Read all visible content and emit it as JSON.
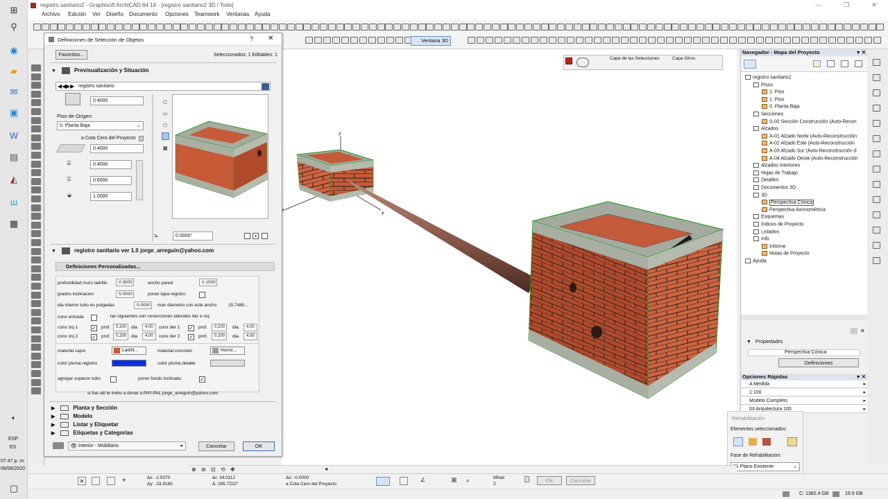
{
  "window": {
    "title": "registro sanitario2 - Graphisoft ArchiCAD-64 18 - [registro sanitario2 3D / Todo]"
  },
  "menu": [
    "Archivo",
    "Edición",
    "Ver",
    "Diseño",
    "Documento",
    "Opciones",
    "Teamwork",
    "Ventanas",
    "Ayuda"
  ],
  "toolbar": {
    "window3d_label": "Ventana 3D"
  },
  "layers": {
    "sel_label": "Capa de las Selecciones",
    "other_label": "Capa Otros"
  },
  "dialog": {
    "title": "Definiciones de Selección de Objetos",
    "help": "?",
    "favorites": "Favoritos...",
    "selected_info": "Seleccionados: 1 Editables: 1",
    "preview_section": "Previsualización y Situación",
    "object_name": "registro sanitario",
    "height_top": "0.4000",
    "floor_label": "Piso de Origen:",
    "floor_value": "0. Planta Baja",
    "zero_label": "a Cota Cero del Proyecto",
    "elev_value": "0.4000",
    "dim_a": "0.4000",
    "dim_b": "0.6000",
    "dim_c": "1.0000",
    "angle": "0.0000°",
    "lib_part": "registro sanitario ver 1.0  jorge_arreguin@yahoo.com",
    "custom_section": "Definiciones Personalizadas...",
    "params": {
      "prof_muro_label": "profundidad muro ladrillo",
      "prof_muro": "0.3000",
      "ancho_pared_label": "ancho pared",
      "ancho_pared": "0.1500",
      "grados_label": "grados inclinacion",
      "grados": "5.0000",
      "tapa_label": "poner tapa registro",
      "dia_tubo_label": "dia interior tubo en pulgadas",
      "dia_tubo": "0.0000",
      "max_dia_label": "max diametro con este ancho",
      "max_dia": "15.7480...",
      "conx_entrada_label": "conx entrada",
      "siguientes_label": "las siguientes son conecciones laterales der e izq",
      "izq1": "conx izq 1",
      "izq2": "conx izq 2",
      "der1": "conx der 1",
      "der2": "conx der 2",
      "prof": "prof.",
      "dia": "dia.",
      "v0200": "0.200",
      "v400": "4.00",
      "mat_cajon_label": "material cajon",
      "mat_cajon": "Ladrill...",
      "mat_concreto_label": "material concreto",
      "mat_concreto": "Hormi...",
      "pluma_reg_label": "color pluma registro",
      "pluma_det_label": "color pluma detalle",
      "espesor_label": "agregar espesor tubo",
      "fondo_label": "poner fondo inclinado",
      "donate": "si fue util te invito a donar a PAY-PAL jorge_arreguin@yahoo.com"
    },
    "sections": [
      "Planta y Sección",
      "Modelo",
      "Listar y Etiquetar",
      "Etiquetas y Categorías"
    ],
    "layer_value": "Interior - Mobiliario",
    "cancel": "Cancelar",
    "ok": "OK"
  },
  "viewport": {
    "axis_z": "z",
    "axis_x": "x",
    "axis_y": "y"
  },
  "navigator": {
    "title": "Navegador - Mapa del Proyecto",
    "tree": [
      {
        "label": "registro sanitario2",
        "level": 0
      },
      {
        "label": "Pisos",
        "level": 1
      },
      {
        "label": "2. Piso",
        "level": 2
      },
      {
        "label": "1. Piso",
        "level": 2
      },
      {
        "label": "0. Planta Baja",
        "level": 2
      },
      {
        "label": "Secciones",
        "level": 1
      },
      {
        "label": "S-02 Sección Construcción (Auto-Recon",
        "level": 2
      },
      {
        "label": "Alzados",
        "level": 1
      },
      {
        "label": "A-01 Alzado Norte (Auto-Reconstrucción",
        "level": 2
      },
      {
        "label": "A-02 Alzado Este (Auto-Reconstrucción",
        "level": 2
      },
      {
        "label": "A-03 Alzado Sur (Auto-Reconstrucción d",
        "level": 2
      },
      {
        "label": "A-04 Alzado Oeste (Auto-Reconstrucción",
        "level": 2
      },
      {
        "label": "Alzados Interiores",
        "level": 1
      },
      {
        "label": "Hojas de Trabajo",
        "level": 1
      },
      {
        "label": "Detalles",
        "level": 1
      },
      {
        "label": "Documentos 3D",
        "level": 1
      },
      {
        "label": "3D",
        "level": 1
      },
      {
        "label": "Perspectiva Cónica",
        "level": 2
      },
      {
        "label": "Perspectiva Axonométrica",
        "level": 2
      },
      {
        "label": "Esquemas",
        "level": 1
      },
      {
        "label": "Índices de Proyecto",
        "level": 1
      },
      {
        "label": "Listados",
        "level": 1
      },
      {
        "label": "Info.",
        "level": 1
      },
      {
        "label": "Informe",
        "level": 2
      },
      {
        "label": "Notas de Proyecto",
        "level": 2
      },
      {
        "label": "Ayuda",
        "level": 0
      }
    ],
    "props_label": "Propiedades",
    "props_value": "Perspectiva Cónica",
    "defs_button": "Definiciones"
  },
  "quick_options": {
    "title": "Opciones Rápidas",
    "items": [
      "A Medida",
      "1:100",
      "Modelo Completo",
      "03 Arquitectura 100"
    ]
  },
  "rehab": {
    "title": "Rehabilitación",
    "elements_label": "Elementos seleccionados:",
    "phase_label": "Fase de Rehabilitación:",
    "phase_value": "01 Plano Existente"
  },
  "status": {
    "dx": "Δx: -2.5370",
    "dy": "Δy: -33.9165",
    "r": "Δr: 34.0112",
    "a": "Δ: 265.7222°",
    "z": "Δz: -0.0000",
    "ref": "a Cota Cero del Proyecto",
    "mitad": "Mitad",
    "mitad_n": "2",
    "ok": "OK",
    "cancel": "Cancelar"
  },
  "taskbar": {
    "lang": "ESP",
    "lang2": "ES",
    "time": "07:47 p. m.",
    "date": "06/06/2020"
  },
  "disk": {
    "c": "C: 1382.4 GB",
    "d": "19.9 GB"
  }
}
